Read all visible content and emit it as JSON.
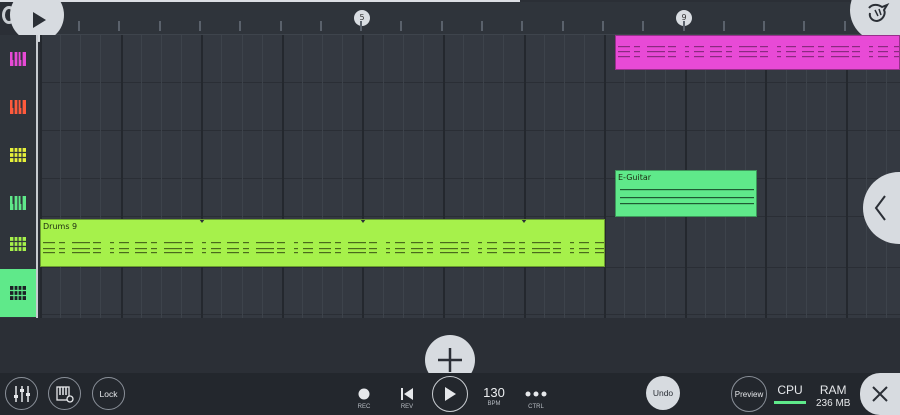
{
  "ruler": {
    "markers": [
      "5",
      "9"
    ]
  },
  "tracks": [
    {
      "icon": "piano-pink-icon",
      "color": "#e84ad6"
    },
    {
      "icon": "piano-red-icon",
      "color": "#ff5a3c"
    },
    {
      "icon": "drumpad-yellow-icon",
      "color": "#e6f03a"
    },
    {
      "icon": "piano-green-icon",
      "color": "#5fe98a"
    },
    {
      "icon": "drumpad-lime-icon",
      "color": "#a6f14b"
    },
    {
      "icon": "drumpad-dark-icon",
      "color": "#5fe98a",
      "selected": true
    }
  ],
  "clips": [
    {
      "name": "",
      "color": "#e84ad6"
    },
    {
      "name": "E-Guitar",
      "color": "#5fe98a"
    },
    {
      "name": "Drums 9",
      "color": "#a6f14b"
    }
  ],
  "toolbar": {
    "lock_label": "Lock",
    "rec_label": "REC",
    "rev_label": "REV",
    "bpm_value": "130",
    "bpm_label": "BPM",
    "ctrl_label": "CTRL",
    "undo_label": "Undo",
    "preview_label": "Preview",
    "cpu_label": "CPU",
    "ram_label": "RAM",
    "ram_value": "236 MB"
  },
  "colors": {
    "accent": "#5fe98a",
    "panel": "#2b2f36",
    "button": "#d7dbe0"
  }
}
